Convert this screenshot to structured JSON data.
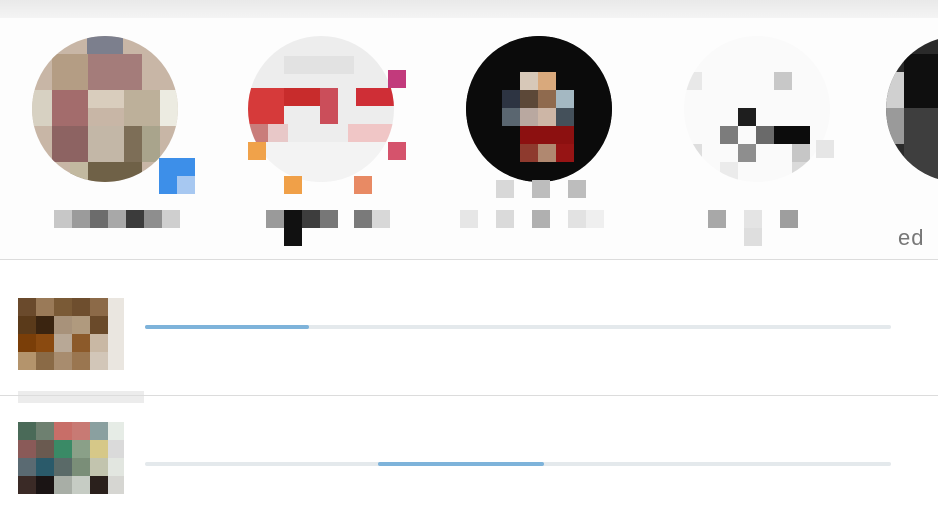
{
  "stories": {
    "items": [
      {
        "id": "story-1",
        "name": ""
      },
      {
        "id": "story-2",
        "name": ""
      },
      {
        "id": "story-3",
        "name": ""
      },
      {
        "id": "story-4",
        "name": ""
      },
      {
        "id": "story-5",
        "name": "ed"
      }
    ],
    "badge_icon": "blue-square-badge-icon"
  },
  "media_list": {
    "items": [
      {
        "kind": "image",
        "progress": 0.22
      },
      {
        "kind": "image",
        "progress": 0.54
      }
    ]
  },
  "colors": {
    "accent": "#7eb3da",
    "track": "#e4e9ec",
    "background": "#ffffff"
  }
}
